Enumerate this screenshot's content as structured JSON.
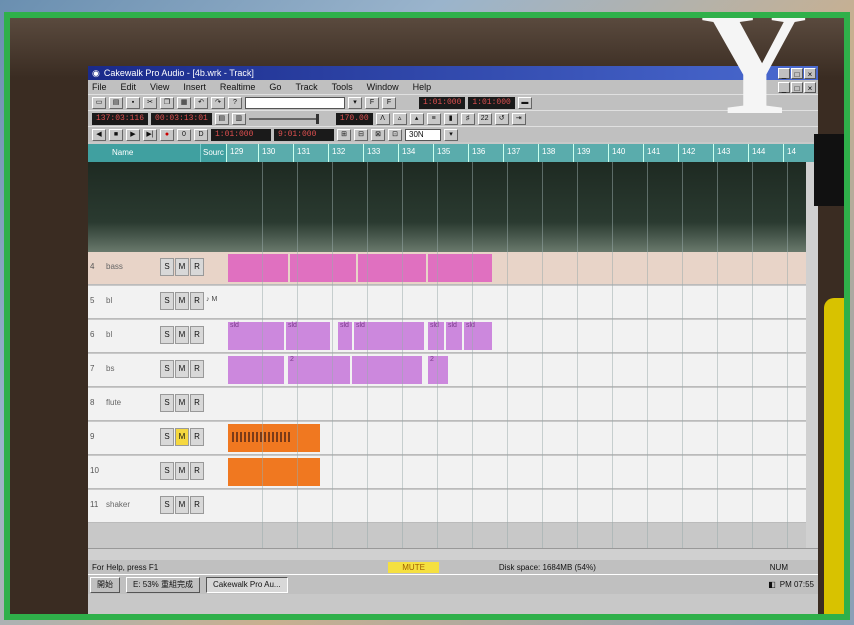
{
  "window": {
    "title": "Cakewalk Pro Audio - [4b.wrk - Track]",
    "controls": [
      "_",
      "□",
      "×"
    ]
  },
  "menu": [
    "File",
    "Edit",
    "View",
    "Insert",
    "Realtime",
    "Go",
    "Track",
    "Tools",
    "Window",
    "Help"
  ],
  "toolbar1": {
    "time_a": "1:01:000",
    "time_b": "1:01:000"
  },
  "toolbar2": {
    "counter": "137:03:116",
    "smpte": "00:03:13:01",
    "tempo": "170.00"
  },
  "toolbar3": {
    "from": "1:01:000",
    "thru": "9:01:000",
    "zoom": "30N"
  },
  "header": {
    "name_col": "Name",
    "source_col": "Sourc",
    "ruler": [
      "129",
      "130",
      "131",
      "132",
      "133",
      "134",
      "135",
      "136",
      "137",
      "138",
      "139",
      "140",
      "141",
      "142",
      "143",
      "144",
      "14"
    ]
  },
  "tracks": [
    {
      "num": "4",
      "name": "bass",
      "s": "S",
      "m": "M",
      "r": "R",
      "source": ""
    },
    {
      "num": "5",
      "name": "bl",
      "s": "S",
      "m": "M",
      "r": "R",
      "source": "♪ M"
    },
    {
      "num": "6",
      "name": "bl",
      "s": "S",
      "m": "M",
      "r": "R",
      "source": ""
    },
    {
      "num": "7",
      "name": "bs",
      "s": "S",
      "m": "M",
      "r": "R",
      "source": ""
    },
    {
      "num": "8",
      "name": "flute",
      "s": "S",
      "m": "M",
      "r": "R",
      "source": ""
    },
    {
      "num": "9",
      "name": "",
      "s": "S",
      "m": "M",
      "r": "R",
      "source": ""
    },
    {
      "num": "10",
      "name": "",
      "s": "S",
      "m": "M",
      "r": "R",
      "source": ""
    },
    {
      "num": "11",
      "name": "shaker",
      "s": "S",
      "m": "M",
      "r": "R",
      "source": ""
    }
  ],
  "clips": {
    "row6": [
      "sld",
      "sld",
      "sld",
      "sld",
      "sld",
      "sld",
      "sld"
    ],
    "row7": [
      "2",
      "2"
    ]
  },
  "status": {
    "help": "For Help, press F1",
    "mute": "MUTE",
    "disk": "Disk space: 1684MB (54%)",
    "num": "NUM"
  },
  "taskbar": {
    "start": "開始",
    "task1": "E: 53% 重組完成",
    "task2": "Cakewalk Pro Au...",
    "clock": "PM 07:55"
  },
  "overlay": {
    "letter": "Y"
  },
  "colors": {
    "frame": "#2fb04a",
    "magenta_clip": "#e070c0",
    "violet_clip": "#cc88dd",
    "orange_clip": "#f07820",
    "mute": "#f5e040"
  }
}
